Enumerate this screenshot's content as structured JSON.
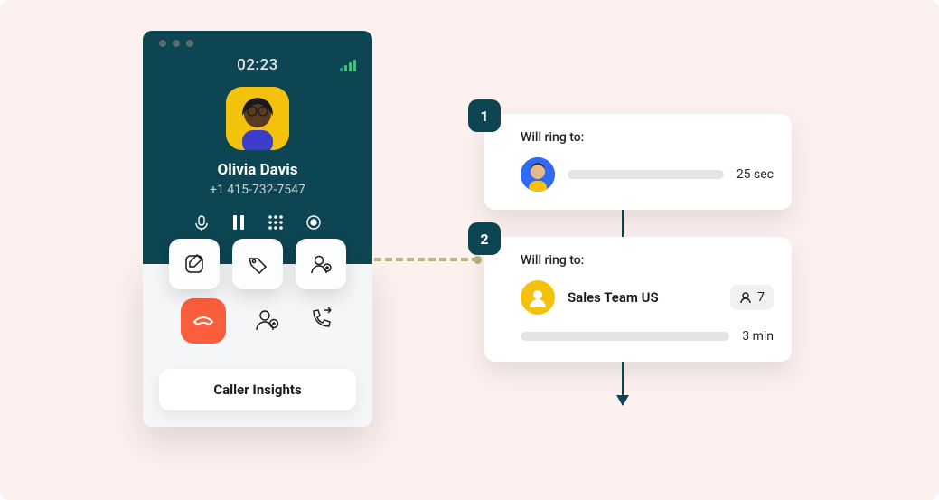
{
  "colors": {
    "panel_bg": "#fcf1ee",
    "header_bg": "#0d4553",
    "hangup": "#fb5e3c",
    "signal": "#2ecc71",
    "avatar_bg": "#f4c20d"
  },
  "call": {
    "timer": "02:23",
    "caller_name": "Olivia Davis",
    "caller_number": "+1 415-732-7547"
  },
  "buttons": {
    "insights": "Caller Insights"
  },
  "flow": {
    "step1": {
      "number": "1",
      "title": "Will ring to:",
      "duration": "25 sec"
    },
    "step2": {
      "number": "2",
      "title": "Will ring to:",
      "team_name": "Sales Team US",
      "member_count": "7",
      "duration": "3 min"
    }
  }
}
